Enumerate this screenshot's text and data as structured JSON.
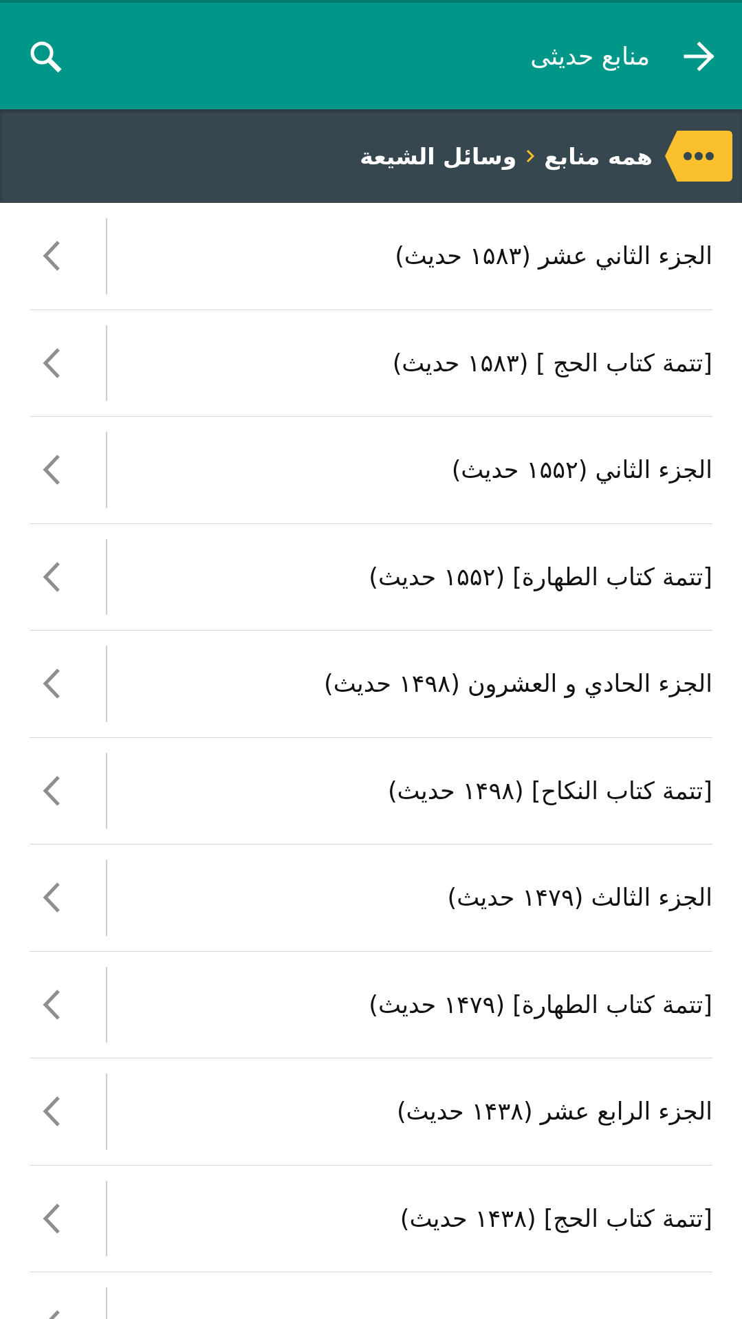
{
  "app_bar": {
    "title": "منابع حدیثی"
  },
  "breadcrumb": {
    "items": [
      {
        "label": "همه منابع"
      },
      {
        "label": "وسائل الشيعة"
      }
    ]
  },
  "list": {
    "items": [
      {
        "label": "الجزء الثاني عشر (۱۵۸۳ حديث)"
      },
      {
        "label": "[تتمة كتاب الحج ] (۱۵۸۳ حديث)"
      },
      {
        "label": "الجزء الثاني (۱۵۵۲ حديث)"
      },
      {
        "label": "[تتمة كتاب الطهارة] (۱۵۵۲ حديث)"
      },
      {
        "label": "الجزء الحادي و العشرون (۱۴۹۸ حديث)"
      },
      {
        "label": "[تتمة كتاب النكاح] (۱۴۹۸ حديث)"
      },
      {
        "label": "الجزء الثالث (۱۴۷۹ حديث)"
      },
      {
        "label": "[تتمة كتاب الطهارة] (۱۴۷۹ حديث)"
      },
      {
        "label": "الجزء الرابع عشر (۱۴۳۸ حديث)"
      },
      {
        "label": "[تتمة كتاب الحج] (۱۴۳۸ حديث)"
      }
    ]
  }
}
